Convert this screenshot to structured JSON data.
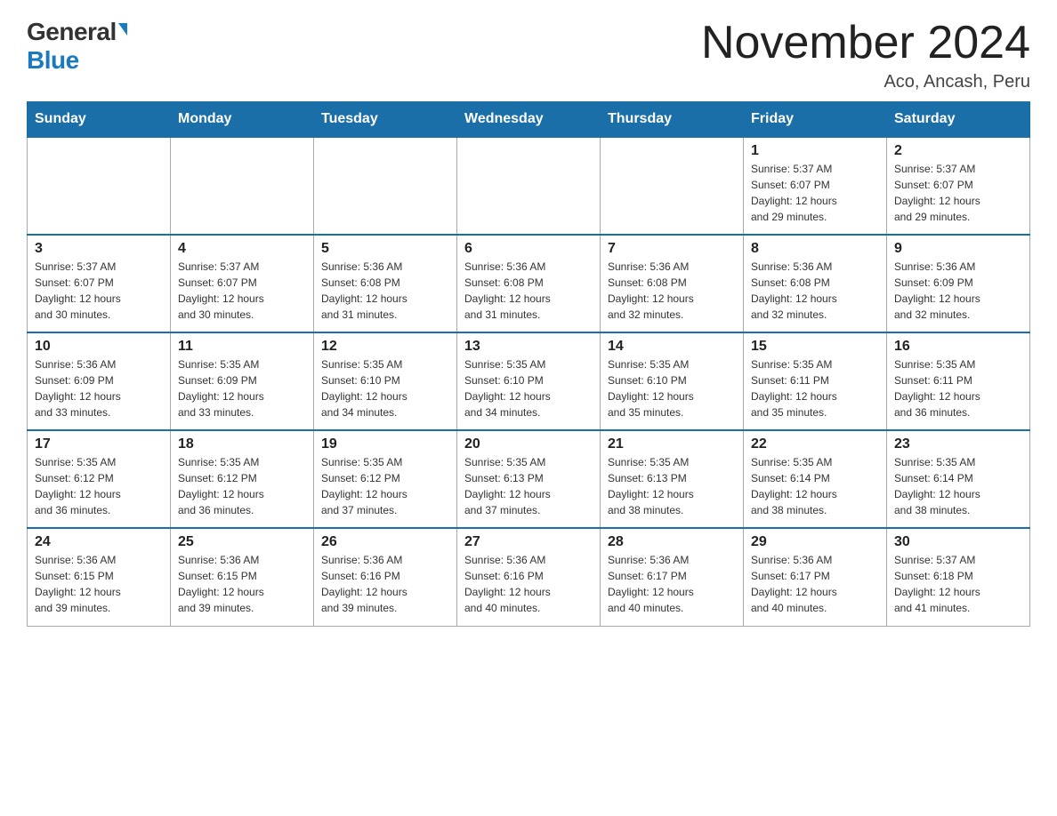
{
  "logo": {
    "general": "General",
    "blue": "Blue"
  },
  "title": "November 2024",
  "location": "Aco, Ancash, Peru",
  "days_of_week": [
    "Sunday",
    "Monday",
    "Tuesday",
    "Wednesday",
    "Thursday",
    "Friday",
    "Saturday"
  ],
  "weeks": [
    [
      {
        "day": "",
        "info": ""
      },
      {
        "day": "",
        "info": ""
      },
      {
        "day": "",
        "info": ""
      },
      {
        "day": "",
        "info": ""
      },
      {
        "day": "",
        "info": ""
      },
      {
        "day": "1",
        "info": "Sunrise: 5:37 AM\nSunset: 6:07 PM\nDaylight: 12 hours\nand 29 minutes."
      },
      {
        "day": "2",
        "info": "Sunrise: 5:37 AM\nSunset: 6:07 PM\nDaylight: 12 hours\nand 29 minutes."
      }
    ],
    [
      {
        "day": "3",
        "info": "Sunrise: 5:37 AM\nSunset: 6:07 PM\nDaylight: 12 hours\nand 30 minutes."
      },
      {
        "day": "4",
        "info": "Sunrise: 5:37 AM\nSunset: 6:07 PM\nDaylight: 12 hours\nand 30 minutes."
      },
      {
        "day": "5",
        "info": "Sunrise: 5:36 AM\nSunset: 6:08 PM\nDaylight: 12 hours\nand 31 minutes."
      },
      {
        "day": "6",
        "info": "Sunrise: 5:36 AM\nSunset: 6:08 PM\nDaylight: 12 hours\nand 31 minutes."
      },
      {
        "day": "7",
        "info": "Sunrise: 5:36 AM\nSunset: 6:08 PM\nDaylight: 12 hours\nand 32 minutes."
      },
      {
        "day": "8",
        "info": "Sunrise: 5:36 AM\nSunset: 6:08 PM\nDaylight: 12 hours\nand 32 minutes."
      },
      {
        "day": "9",
        "info": "Sunrise: 5:36 AM\nSunset: 6:09 PM\nDaylight: 12 hours\nand 32 minutes."
      }
    ],
    [
      {
        "day": "10",
        "info": "Sunrise: 5:36 AM\nSunset: 6:09 PM\nDaylight: 12 hours\nand 33 minutes."
      },
      {
        "day": "11",
        "info": "Sunrise: 5:35 AM\nSunset: 6:09 PM\nDaylight: 12 hours\nand 33 minutes."
      },
      {
        "day": "12",
        "info": "Sunrise: 5:35 AM\nSunset: 6:10 PM\nDaylight: 12 hours\nand 34 minutes."
      },
      {
        "day": "13",
        "info": "Sunrise: 5:35 AM\nSunset: 6:10 PM\nDaylight: 12 hours\nand 34 minutes."
      },
      {
        "day": "14",
        "info": "Sunrise: 5:35 AM\nSunset: 6:10 PM\nDaylight: 12 hours\nand 35 minutes."
      },
      {
        "day": "15",
        "info": "Sunrise: 5:35 AM\nSunset: 6:11 PM\nDaylight: 12 hours\nand 35 minutes."
      },
      {
        "day": "16",
        "info": "Sunrise: 5:35 AM\nSunset: 6:11 PM\nDaylight: 12 hours\nand 36 minutes."
      }
    ],
    [
      {
        "day": "17",
        "info": "Sunrise: 5:35 AM\nSunset: 6:12 PM\nDaylight: 12 hours\nand 36 minutes."
      },
      {
        "day": "18",
        "info": "Sunrise: 5:35 AM\nSunset: 6:12 PM\nDaylight: 12 hours\nand 36 minutes."
      },
      {
        "day": "19",
        "info": "Sunrise: 5:35 AM\nSunset: 6:12 PM\nDaylight: 12 hours\nand 37 minutes."
      },
      {
        "day": "20",
        "info": "Sunrise: 5:35 AM\nSunset: 6:13 PM\nDaylight: 12 hours\nand 37 minutes."
      },
      {
        "day": "21",
        "info": "Sunrise: 5:35 AM\nSunset: 6:13 PM\nDaylight: 12 hours\nand 38 minutes."
      },
      {
        "day": "22",
        "info": "Sunrise: 5:35 AM\nSunset: 6:14 PM\nDaylight: 12 hours\nand 38 minutes."
      },
      {
        "day": "23",
        "info": "Sunrise: 5:35 AM\nSunset: 6:14 PM\nDaylight: 12 hours\nand 38 minutes."
      }
    ],
    [
      {
        "day": "24",
        "info": "Sunrise: 5:36 AM\nSunset: 6:15 PM\nDaylight: 12 hours\nand 39 minutes."
      },
      {
        "day": "25",
        "info": "Sunrise: 5:36 AM\nSunset: 6:15 PM\nDaylight: 12 hours\nand 39 minutes."
      },
      {
        "day": "26",
        "info": "Sunrise: 5:36 AM\nSunset: 6:16 PM\nDaylight: 12 hours\nand 39 minutes."
      },
      {
        "day": "27",
        "info": "Sunrise: 5:36 AM\nSunset: 6:16 PM\nDaylight: 12 hours\nand 40 minutes."
      },
      {
        "day": "28",
        "info": "Sunrise: 5:36 AM\nSunset: 6:17 PM\nDaylight: 12 hours\nand 40 minutes."
      },
      {
        "day": "29",
        "info": "Sunrise: 5:36 AM\nSunset: 6:17 PM\nDaylight: 12 hours\nand 40 minutes."
      },
      {
        "day": "30",
        "info": "Sunrise: 5:37 AM\nSunset: 6:18 PM\nDaylight: 12 hours\nand 41 minutes."
      }
    ]
  ]
}
